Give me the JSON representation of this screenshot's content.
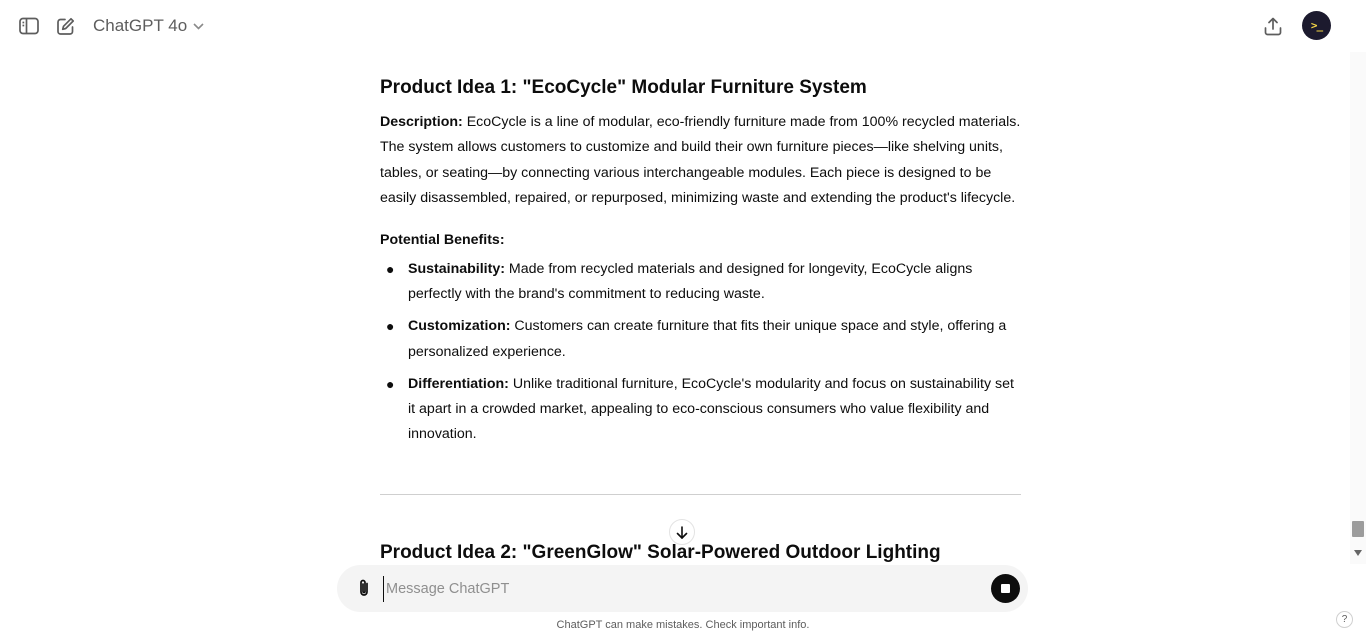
{
  "header": {
    "model_name": "ChatGPT 4o",
    "icons": [
      "sidebar-toggle-icon",
      "new-chat-icon",
      "chevron-down-icon",
      "share-icon"
    ],
    "avatar_text": ">_"
  },
  "message": {
    "idea1": {
      "title": "Product Idea 1: \"EcoCycle\" Modular Furniture System",
      "description_label": "Description:",
      "description_text": " EcoCycle is a line of modular, eco-friendly furniture made from 100% recycled materials. The system allows customers to customize and build their own furniture pieces—like shelving units, tables, or seating—by connecting various interchangeable modules. Each piece is designed to be easily disassembled, repaired, or repurposed, minimizing waste and extending the product's lifecycle.",
      "benefits_heading": "Potential Benefits:",
      "benefits": [
        {
          "label": "Sustainability:",
          "text": " Made from recycled materials and designed for longevity, EcoCycle aligns perfectly with the brand's commitment to reducing waste."
        },
        {
          "label": "Customization:",
          "text": " Customers can create furniture that fits their unique space and style, offering a personalized experience."
        },
        {
          "label": "Differentiation:",
          "text": " Unlike traditional furniture, EcoCycle's modularity and focus on sustainability set it apart in a crowded market, appealing to eco-conscious consumers who value flexibility and innovation."
        }
      ]
    },
    "idea2": {
      "title": "Product Idea 2: \"GreenGlow\" Solar-Powered Outdoor Lighting"
    }
  },
  "composer": {
    "placeholder": "Message ChatGPT",
    "value": ""
  },
  "footer": {
    "disclaimer": "ChatGPT can make mistakes. Check important info.",
    "help_label": "?"
  },
  "colors": {
    "text": "#0d0d0d",
    "muted": "#5d5d5d",
    "composer_bg": "#f4f4f4",
    "avatar_bg": "#1c1a2e"
  }
}
